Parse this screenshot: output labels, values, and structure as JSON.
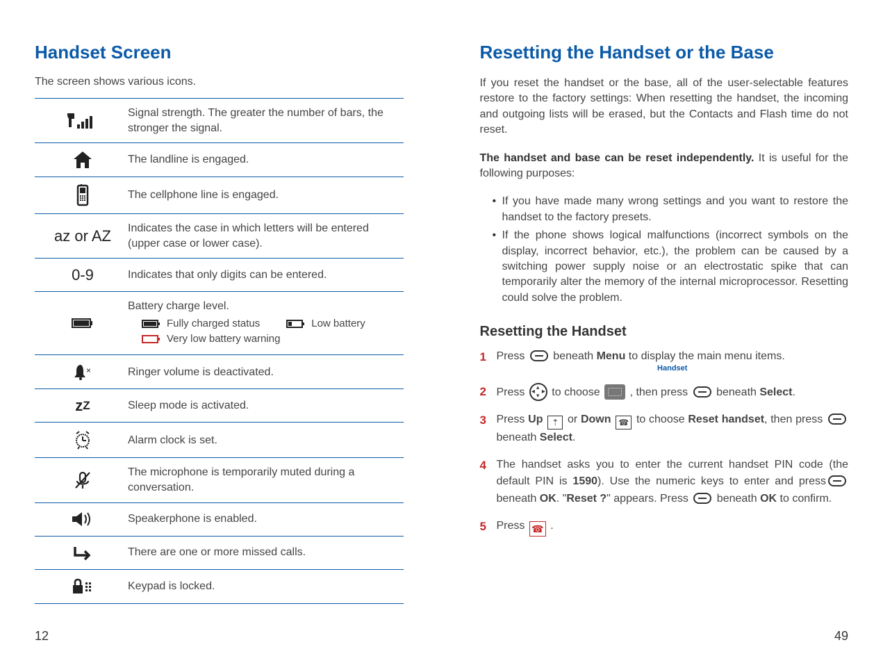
{
  "left": {
    "title": "Handset Screen",
    "intro": "The screen shows various icons.",
    "rows": [
      {
        "icon": "signal",
        "label": "",
        "desc": "Signal strength. The greater the number of bars, the stronger the signal."
      },
      {
        "icon": "home",
        "label": "",
        "desc": "The landline is engaged."
      },
      {
        "icon": "cellphone",
        "label": "",
        "desc": "The cellphone line is engaged."
      },
      {
        "icon": "text",
        "label": "az or AZ",
        "desc": "Indicates the case in which letters will be entered (upper case or lower case)."
      },
      {
        "icon": "text",
        "label": "0-9",
        "desc": "Indicates that only digits can be entered."
      },
      {
        "icon": "battery",
        "label": "",
        "desc": "Battery charge level.",
        "sub": {
          "full": "Fully charged status",
          "low": "Low battery",
          "verylow": "Very low battery warning"
        }
      },
      {
        "icon": "ringer-off",
        "label": "",
        "desc": "Ringer volume is deactivated."
      },
      {
        "icon": "sleep",
        "label": "zZ",
        "desc": "Sleep mode is activated."
      },
      {
        "icon": "alarm",
        "label": "",
        "desc": "Alarm clock is set."
      },
      {
        "icon": "mute",
        "label": "",
        "desc": "The microphone is temporarily muted during a conversation."
      },
      {
        "icon": "speaker",
        "label": "",
        "desc": "Speakerphone is enabled."
      },
      {
        "icon": "missed",
        "label": "",
        "desc": "There are one or more missed calls."
      },
      {
        "icon": "lock",
        "label": "",
        "desc": "Keypad is locked."
      }
    ]
  },
  "right": {
    "title": "Resetting the Handset or the Base",
    "p1": "If you reset the handset or the base, all of the user-selectable features restore to the factory settings: When resetting the handset, the incoming and outgoing lists will be erased, but the Contacts and Flash time do not reset.",
    "p2_lead": "The handset and base can be reset independently.",
    "p2_rest": " It is useful for the following purposes:",
    "bullets": [
      "If you have made many wrong settings and you want to restore the handset to the factory presets.",
      "If the phone shows logical malfunctions (incorrect symbols on the display, incorrect behavior, etc.), the problem can be caused by a switching power supply noise or an electrostatic spike that can temporarily alter the memory of the internal microprocessor. Resetting could solve the problem."
    ],
    "subhead": "Resetting the Handset",
    "handset_caption": "Handset",
    "steps": {
      "s1a": "Press ",
      "s1b": " beneath ",
      "s1_menu": "Menu",
      "s1c": " to display the main menu items.",
      "s2a": "Press ",
      "s2b": " to choose ",
      "s2c": " , then press ",
      "s2d": " beneath ",
      "s2_select": "Select",
      "s2e": ".",
      "s3a": "Press ",
      "s3_up": "Up",
      "s3b": " or ",
      "s3_down": "Down",
      "s3c": " to choose ",
      "s3_reset": "Reset handset",
      "s3d": ", then press ",
      "s3e": " beneath ",
      "s3_select": "Select",
      "s3f": ".",
      "s4a": "The handset asks you to enter the current handset PIN code (the default PIN is ",
      "s4_pin": "1590",
      "s4b": "). Use the numeric keys to enter and press",
      "s4c": "beneath ",
      "s4_ok1": "OK",
      "s4d": ". \"",
      "s4_resetq": "Reset ?",
      "s4e": "\" appears. Press ",
      "s4f": " beneath ",
      "s4_ok2": "OK",
      "s4g": " to confirm.",
      "s5a": "Press ",
      "s5b": " ."
    }
  },
  "page_numbers": {
    "left": "12",
    "right": "49"
  }
}
